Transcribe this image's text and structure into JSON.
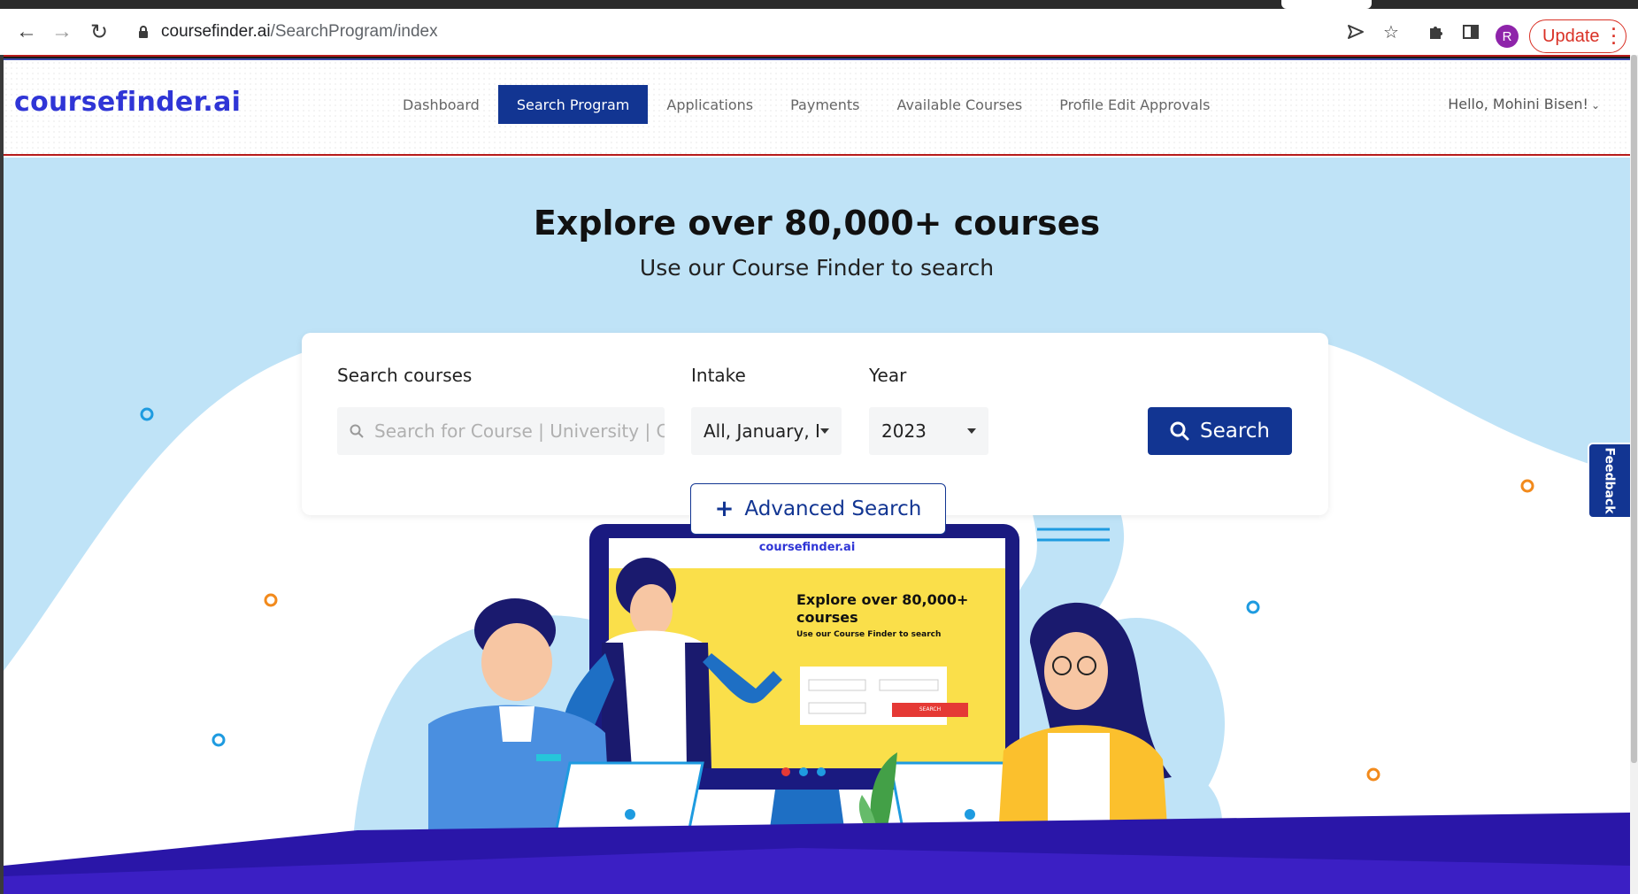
{
  "browser": {
    "url_host": "coursefinder.ai",
    "url_path": "/SearchProgram/index",
    "avatar_letter": "R",
    "update_label": "Update"
  },
  "header": {
    "logo": "coursefinder.ai",
    "nav": [
      {
        "label": "Dashboard",
        "active": false
      },
      {
        "label": "Search Program",
        "active": true
      },
      {
        "label": "Applications",
        "active": false
      },
      {
        "label": "Payments",
        "active": false
      },
      {
        "label": "Available Courses",
        "active": false
      },
      {
        "label": "Profile Edit Approvals",
        "active": false
      }
    ],
    "greeting": "Hello,  Mohini Bisen!"
  },
  "hero": {
    "title": "Explore over 80,000+ courses",
    "subtitle": "Use our Course Finder to search"
  },
  "search": {
    "courses_label": "Search courses",
    "courses_placeholder": "Search for Course | University | Country",
    "intake_label": "Intake",
    "intake_value": "All, January, Fel",
    "year_label": "Year",
    "year_value": "2023",
    "button_label": "Search",
    "advanced_label": "Advanced Search"
  },
  "illustration": {
    "screen_logo": "coursefinder.ai",
    "screen_title_line1": "Explore over 80,000+",
    "screen_title_line2": "courses",
    "screen_subtitle": "Use our Course Finder to search",
    "screen_button": "SEARCH"
  },
  "feedback_label": "Feedback",
  "colors": {
    "brand_blue": "#123592",
    "logo_blue": "#2f35d6",
    "hero_bg": "#bfe3f7",
    "accent_red": "#b71c1c"
  }
}
